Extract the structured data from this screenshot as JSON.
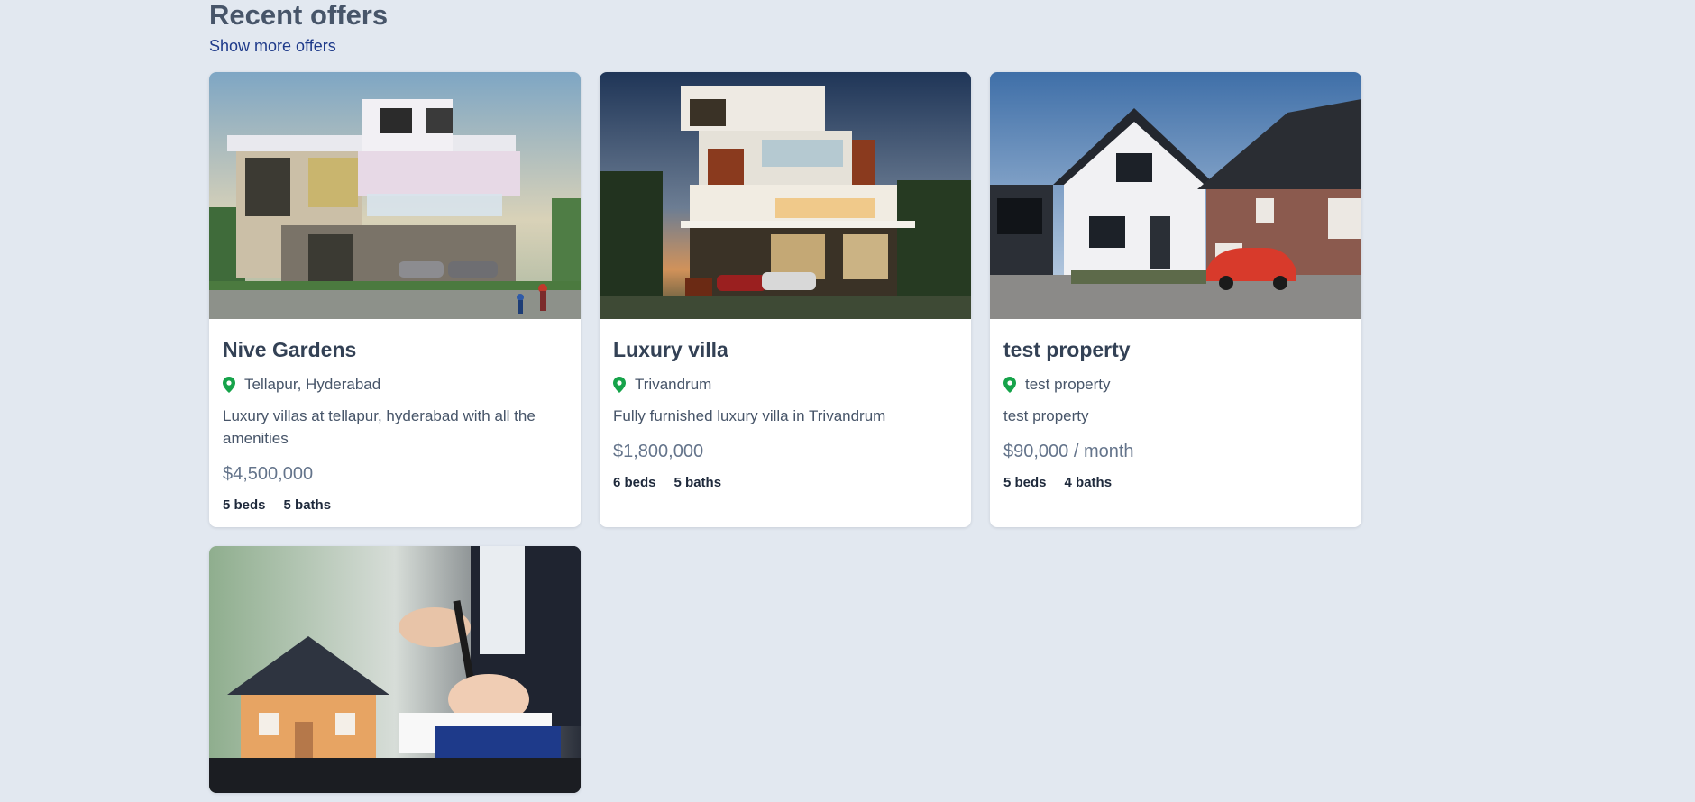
{
  "section": {
    "title": "Recent offers",
    "show_more_label": "Show more offers"
  },
  "colors": {
    "page_background": "#e2e8f0",
    "link": "#1e3a8a",
    "pin": "#16a34a"
  },
  "listings": [
    {
      "title": "Nive Gardens",
      "location": "Tellapur, Hyderabad",
      "description": "Luxury villas at tellapur, hyderabad with all the amenities",
      "price": "$4,500,000",
      "beds": "5 beds",
      "baths": "5 baths",
      "image_icon": "modern-villa-photo"
    },
    {
      "title": "Luxury villa",
      "location": "Trivandrum",
      "description": "Fully furnished luxury villa in Trivandrum",
      "price": "$1,800,000",
      "beds": "6 beds",
      "baths": "5 baths",
      "image_icon": "villa-dusk-photo"
    },
    {
      "title": "test property",
      "location": "test property",
      "description": "test property",
      "price": "$90,000 / month",
      "beds": "5 beds",
      "baths": "4 baths",
      "image_icon": "suburban-house-photo"
    },
    {
      "image_icon": "house-contract-photo"
    }
  ]
}
